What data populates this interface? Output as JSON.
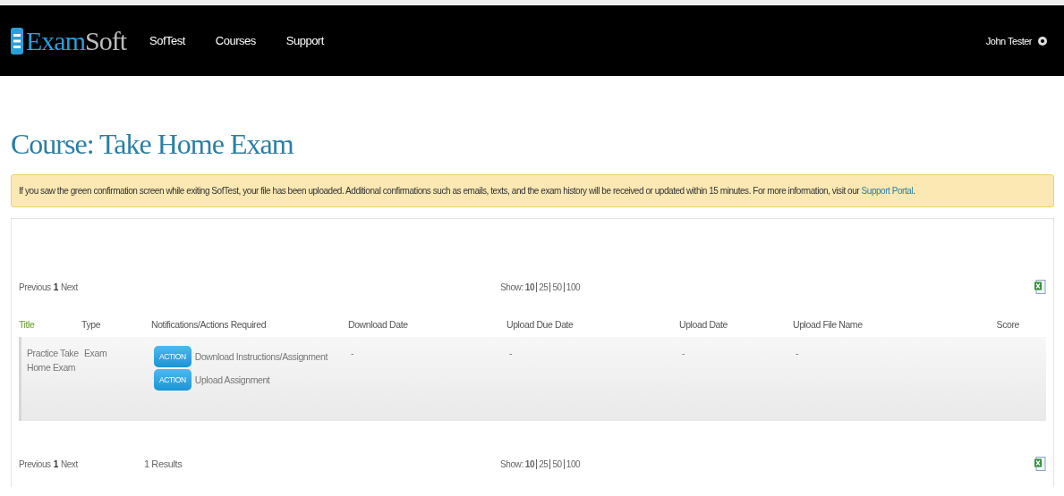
{
  "header": {
    "logo": {
      "part_1": "Exam",
      "part_2": "Soft"
    },
    "nav": [
      "SofTest",
      "Courses",
      "Support"
    ],
    "user": "John Tester"
  },
  "page_title": "Course: Take Home Exam",
  "notice": {
    "text": "If you saw the green confirmation screen while exiting SofTest, your file has been uploaded. Additional confirmations such as emails, texts, and the exam history will be received or updated within 15 minutes. For more information, visit our",
    "link": "Support Portal",
    "end": "."
  },
  "top_pager": {
    "previous": "Previous",
    "page": "1",
    "next": "Next",
    "show_label": "Show:",
    "sizes": [
      {
        "label": "10",
        "selected": true
      },
      {
        "label": "25",
        "selected": false
      },
      {
        "label": "50",
        "selected": false
      },
      {
        "label": "100",
        "selected": false
      }
    ]
  },
  "columns": [
    {
      "label": "Title",
      "sorted": true
    },
    {
      "label": "Type",
      "sorted": false
    },
    {
      "label": "Notifications/Actions Required",
      "sorted": false
    },
    {
      "label": "Download Date",
      "sorted": false
    },
    {
      "label": "Upload Due Date",
      "sorted": false
    },
    {
      "label": "Upload Date",
      "sorted": false
    },
    {
      "label": "Upload File Name",
      "sorted": false
    },
    {
      "label": "Score",
      "sorted": false
    }
  ],
  "rows": [
    {
      "title": "Practice Take Home Exam",
      "type": "Exam",
      "actions": [
        {
          "badge": "ACTION",
          "label": "Download Instructions/Assignment"
        },
        {
          "badge": "ACTION",
          "label": "Upload Assignment"
        }
      ],
      "download_date": "-",
      "upload_due_date": "-",
      "upload_date": "-",
      "upload_file_name": "-"
    }
  ],
  "bottom_pager": {
    "previous": "Previous",
    "page": "1",
    "next": "Next",
    "results": "1 Results",
    "show_label": "Show:",
    "sizes": [
      {
        "label": "10",
        "selected": true
      },
      {
        "label": "25",
        "selected": false
      },
      {
        "label": "50",
        "selected": false
      },
      {
        "label": "100",
        "selected": false
      }
    ]
  }
}
